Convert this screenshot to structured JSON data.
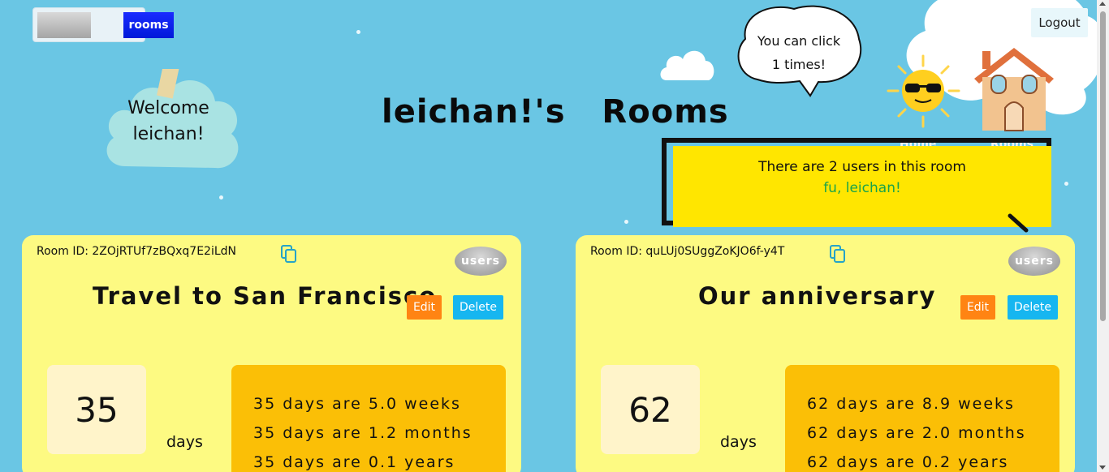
{
  "header": {
    "toggle_label": "rooms",
    "welcome_line1": "Welcome",
    "welcome_line2": "leichan!",
    "page_title": "leichan!'s  Rooms",
    "speech_line1": "You can click",
    "speech_line2": "1 times!",
    "logout_label": "Logout",
    "nav_hidden_1": "Home",
    "nav_hidden_2": "Rooms"
  },
  "popup": {
    "line1": "There are 2 users in this room",
    "line2": "fu, leichan!"
  },
  "rooms": [
    {
      "room_id_text": "Room ID: 2ZOjRTUf7zBQxq7E2iLdN",
      "users_label": "users",
      "title": "Travel to San Francisco",
      "edit_label": "Edit",
      "delete_label": "Delete",
      "count": "35",
      "days_label": "days",
      "conversions": [
        "35 days are 5.0 weeks",
        "35 days are 1.2 months",
        "35 days are 0.1 years"
      ]
    },
    {
      "room_id_text": "Room ID: quLUj0SUggZoKJO6f-y4T",
      "users_label": "users",
      "title": "Our anniversary",
      "edit_label": "Edit",
      "delete_label": "Delete",
      "count": "62",
      "days_label": "days",
      "conversions": [
        "62 days are 8.9 weeks",
        "62 days are 2.0 months",
        "62 days are 0.2 years"
      ]
    }
  ],
  "colors": {
    "background": "#6ac6e4",
    "card": "#fdfa82",
    "conversion_box": "#fbbf06",
    "popup": "#ffe600",
    "edit": "#ff8413",
    "delete": "#16b6f0",
    "toggle_on": "#0019d9"
  },
  "icons": [
    "copy-icon",
    "sun-icon",
    "house-icon",
    "cloud-icon"
  ]
}
